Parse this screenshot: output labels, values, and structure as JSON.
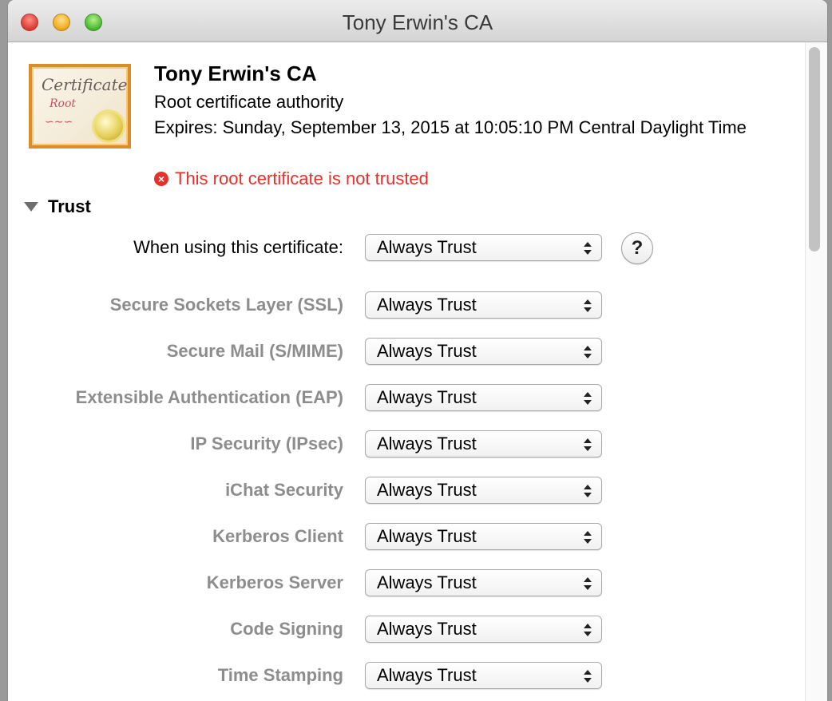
{
  "window": {
    "title": "Tony Erwin's CA"
  },
  "certificate": {
    "icon": "certificate-icon",
    "icon_text": "Certificate",
    "icon_subtext": "Root",
    "name": "Tony Erwin's CA",
    "kind": "Root certificate authority",
    "expires": "Expires: Sunday, September 13, 2015 at 10:05:10 PM Central Daylight Time",
    "status": "This root certificate is not trusted",
    "status_icon": "error-x-icon",
    "status_color": "#e8302a"
  },
  "trust": {
    "section_label": "Trust",
    "expanded": true,
    "when_using": {
      "label": "When using this certificate:",
      "value": "Always Trust"
    },
    "help_label": "?",
    "policies": [
      {
        "label": "Secure Sockets Layer (SSL)",
        "value": "Always Trust"
      },
      {
        "label": "Secure Mail (S/MIME)",
        "value": "Always Trust"
      },
      {
        "label": "Extensible Authentication (EAP)",
        "value": "Always Trust"
      },
      {
        "label": "IP Security (IPsec)",
        "value": "Always Trust"
      },
      {
        "label": "iChat Security",
        "value": "Always Trust"
      },
      {
        "label": "Kerberos Client",
        "value": "Always Trust"
      },
      {
        "label": "Kerberos Server",
        "value": "Always Trust"
      },
      {
        "label": "Code Signing",
        "value": "Always Trust"
      },
      {
        "label": "Time Stamping",
        "value": "Always Trust"
      }
    ]
  }
}
